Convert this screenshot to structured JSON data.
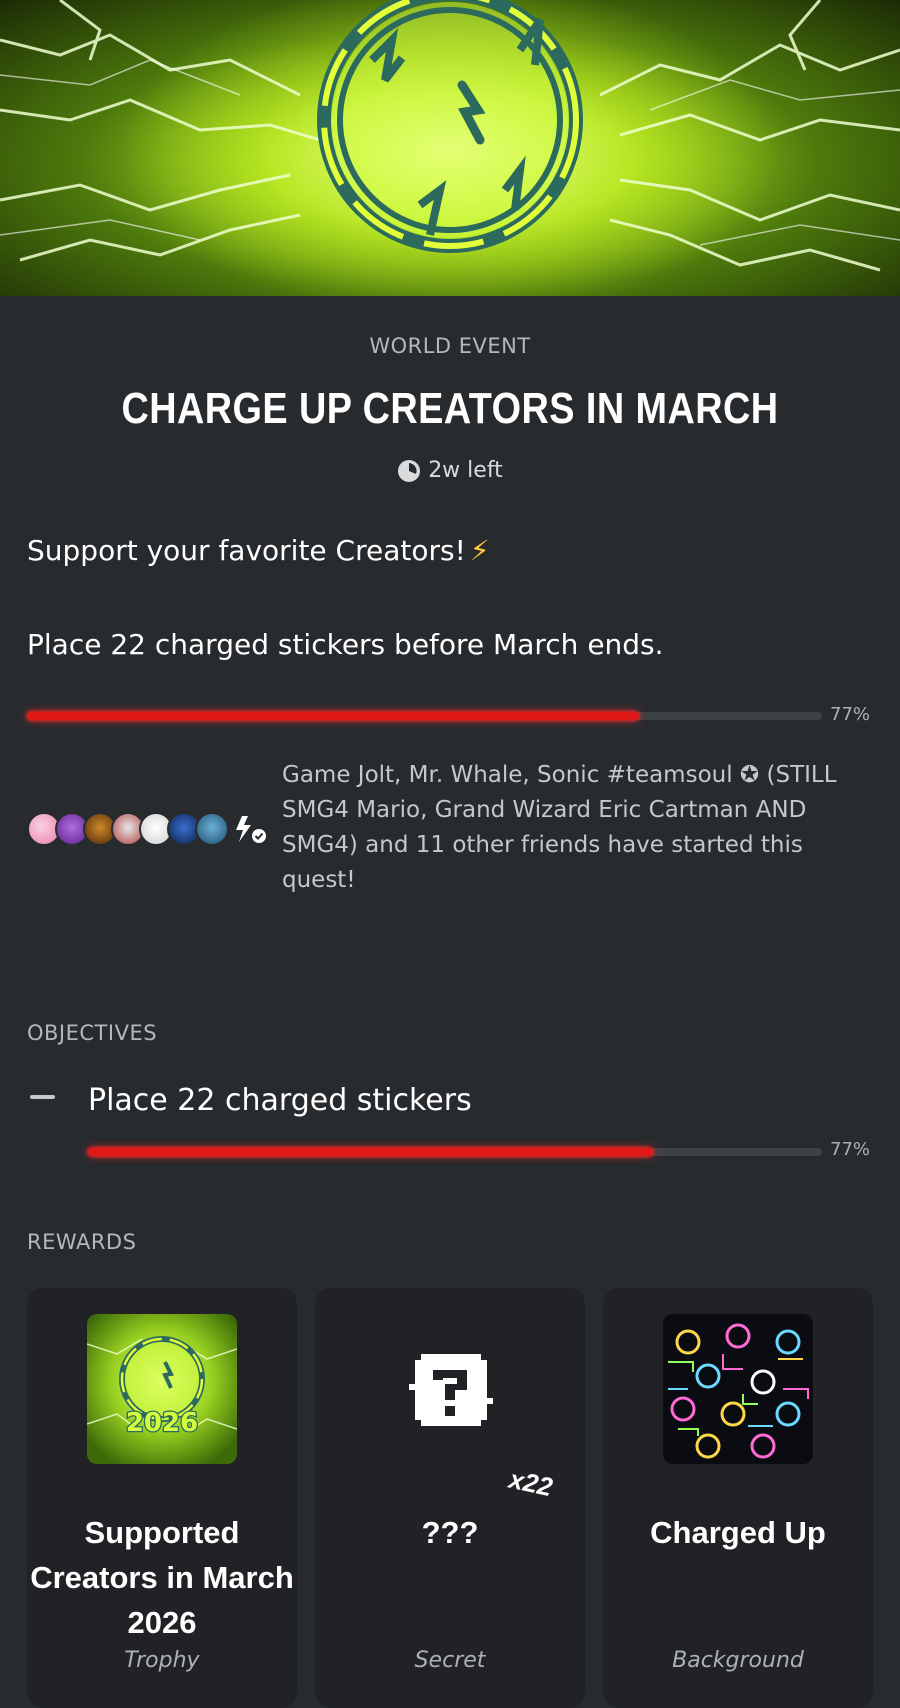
{
  "event": {
    "type_label": "WORLD EVENT",
    "title": "CHARGE UP CREATORS IN MARCH",
    "time_left": "2w left",
    "tagline": "Support your favorite Creators!",
    "tagline_emoji": "⚡",
    "description": "Place 22 charged stickers before March ends.",
    "progress_percent": 77,
    "progress_label": "77%",
    "friends_text": "Game Jolt, Mr. Whale, Sonic #teamsoul ✪ (STILL SMG4 Mario, Grand Wizard Eric Cartman AND SMG4) and 11 other friends have started this quest!"
  },
  "objectives": {
    "section_label": "OBJECTIVES",
    "items": [
      {
        "label": "Place 22 charged stickers",
        "progress_percent": 77,
        "progress_label": "77%"
      }
    ]
  },
  "rewards": {
    "section_label": "REWARDS",
    "items": [
      {
        "name": "Supported Creators in March 2026",
        "type": "Trophy",
        "badge_text": "2026"
      },
      {
        "name": "???",
        "type": "Secret",
        "multiplier": "x22"
      },
      {
        "name": "Charged Up",
        "type": "Background"
      }
    ]
  },
  "colors": {
    "background": "#282b2e",
    "card": "#202225",
    "progress_fill": "#e01818",
    "accent_green": "#c8f020"
  },
  "icons": {
    "clock": "clock-icon",
    "objective_marker": "dash-icon"
  }
}
